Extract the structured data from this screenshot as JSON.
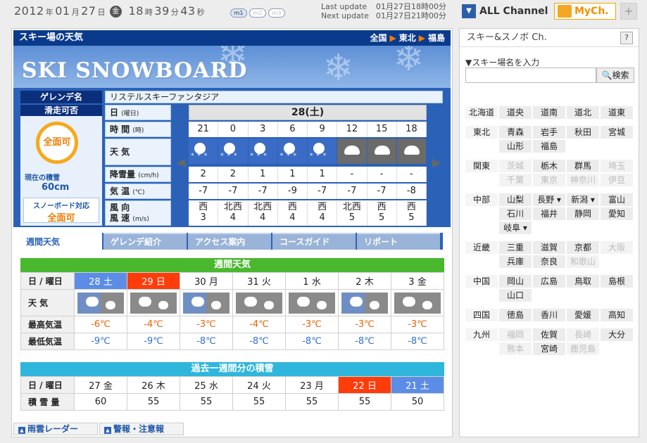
{
  "topbar": {
    "year": "2012",
    "month": "01",
    "day": "27",
    "weekday": "金",
    "hour": "18",
    "minute": "39",
    "second": "43",
    "u_year": "年",
    "u_month": "月",
    "u_day": "日",
    "u_hour": "時",
    "u_minute": "分",
    "u_second": "秒",
    "modes": [
      "m1",
      "m2",
      "m3"
    ],
    "last_label": "Last update",
    "last_value": "01月27日18時00分",
    "next_label": "Next update",
    "next_value": "01月27日21時00分",
    "all_channel": "ALL Channel",
    "mych": "MyCh.",
    "plus": "+"
  },
  "main": {
    "title": "スキー場の天気",
    "breadcrumb": [
      "全国",
      "東北",
      "福島"
    ],
    "logo": "SKI SNOWBOARD",
    "resort_label": "ゲレンデ名",
    "resort_name": "リステルスキーファンタジア",
    "ski_label": "滑走可否",
    "ski_status": "全面可",
    "accum_label": "現在の積雪",
    "accum_value": "60cm",
    "snowboard_label": "スノーボード対応",
    "snowboard_status": "全面可",
    "rows": {
      "day": "日",
      "day_small": "(曜日)",
      "time": "時 間",
      "time_small": "(時)",
      "weather": "天 気",
      "snow": "降雪量",
      "snow_small": "(cm/h)",
      "temp": "気 温",
      "temp_small": "(℃)",
      "wind1": "風 向",
      "wind2": "風 速",
      "wind_small": "(m/s)"
    },
    "date": "28(土)",
    "hours": [
      "21",
      "0",
      "3",
      "6",
      "9",
      "12",
      "15",
      "18"
    ],
    "weather": [
      "snow",
      "snow",
      "snow",
      "snow",
      "snow",
      "cloud",
      "cloud",
      "cloud"
    ],
    "snowfall": [
      "2",
      "2",
      "1",
      "1",
      "1",
      "-",
      "-",
      "-"
    ],
    "temps": [
      "-7",
      "-7",
      "-7",
      "-9",
      "-7",
      "-7",
      "-7",
      "-8"
    ],
    "wind_dir": [
      "西",
      "北西",
      "北西",
      "西",
      "西",
      "北西",
      "西",
      "西"
    ],
    "wind_speed": [
      "3",
      "4",
      "4",
      "4",
      "4",
      "5",
      "5",
      "5"
    ],
    "tabs": [
      "週間天気",
      "ゲレンデ紹介",
      "アクセス案内",
      "コースガイド",
      "リポート"
    ]
  },
  "weekly": {
    "title": "週間天気",
    "row_day": "日 / 曜日",
    "row_weather": "天 気",
    "row_hi": "最高気温",
    "row_lo": "最低気温",
    "days": [
      "28 土",
      "29 日",
      "30 月",
      "31 火",
      "1 水",
      "2 木",
      "3 金"
    ],
    "icons": [
      "cloud-sun",
      "cloud",
      "cloud-sun",
      "cloud",
      "cloud",
      "cloud-sun",
      "cloud"
    ],
    "hi": [
      "-6℃",
      "-4℃",
      "-3℃",
      "-4℃",
      "-3℃",
      "-3℃",
      "-3℃"
    ],
    "lo": [
      "-9℃",
      "-9℃",
      "-8℃",
      "-8℃",
      "-8℃",
      "-8℃",
      "-8℃"
    ]
  },
  "past": {
    "title": "過去一週間分の積雪",
    "row_day": "日 / 曜日",
    "row_accum": "積 雪 量",
    "days": [
      "27 金",
      "26 木",
      "25 水",
      "24 火",
      "23 月",
      "22 日",
      "21 土"
    ],
    "accum": [
      "60",
      "55",
      "55",
      "55",
      "55",
      "55",
      "50"
    ]
  },
  "footer": [
    "雨雲レーダー",
    "警報・注意報"
  ],
  "side": {
    "title": "スキー&スノボ Ch.",
    "help": "?",
    "search_label": "▼スキー場名を入力",
    "search_button": "検索",
    "regions": [
      {
        "name": "北海道",
        "prefs": [
          [
            "道央",
            1
          ],
          [
            "道南",
            1
          ],
          [
            "道北",
            1
          ],
          [
            "道東",
            1
          ]
        ]
      },
      {
        "name": "東北",
        "prefs": [
          [
            "青森",
            1
          ],
          [
            "岩手",
            1
          ],
          [
            "秋田",
            1
          ],
          [
            "宮城",
            1
          ],
          [
            "山形",
            1
          ],
          [
            "福島",
            1
          ]
        ]
      },
      {
        "name": "関東",
        "prefs": [
          [
            "茨城",
            0
          ],
          [
            "栃木",
            1
          ],
          [
            "群馬",
            1
          ],
          [
            "埼玉",
            0
          ],
          [
            "千葉",
            0
          ],
          [
            "東京",
            0
          ],
          [
            "神奈川",
            0
          ],
          [
            "伊豆",
            0
          ]
        ]
      },
      {
        "name": "中部",
        "prefs": [
          [
            "山梨",
            1
          ],
          [
            "長野 ▾",
            1
          ],
          [
            "新潟 ▾",
            1
          ],
          [
            "富山",
            1
          ],
          [
            "石川",
            1
          ],
          [
            "福井",
            1
          ],
          [
            "静岡",
            1
          ],
          [
            "愛知",
            1
          ],
          [
            "岐阜 ▾",
            1
          ]
        ]
      },
      {
        "name": "近畿",
        "prefs": [
          [
            "三重",
            1
          ],
          [
            "滋賀",
            1
          ],
          [
            "京都",
            1
          ],
          [
            "大阪",
            0
          ],
          [
            "兵庫",
            1
          ],
          [
            "奈良",
            1
          ],
          [
            "和歌山",
            0
          ]
        ]
      },
      {
        "name": "中国",
        "prefs": [
          [
            "岡山",
            1
          ],
          [
            "広島",
            1
          ],
          [
            "鳥取",
            1
          ],
          [
            "島根",
            1
          ],
          [
            "山口",
            1
          ]
        ]
      },
      {
        "name": "四国",
        "prefs": [
          [
            "徳島",
            1
          ],
          [
            "香川",
            1
          ],
          [
            "愛媛",
            1
          ],
          [
            "高知",
            1
          ]
        ]
      },
      {
        "name": "九州",
        "prefs": [
          [
            "福岡",
            0
          ],
          [
            "佐賀",
            1
          ],
          [
            "長崎",
            0
          ],
          [
            "大分",
            1
          ],
          [
            "熊本",
            0
          ],
          [
            "宮崎",
            1
          ],
          [
            "鹿児島",
            0
          ]
        ]
      }
    ]
  }
}
